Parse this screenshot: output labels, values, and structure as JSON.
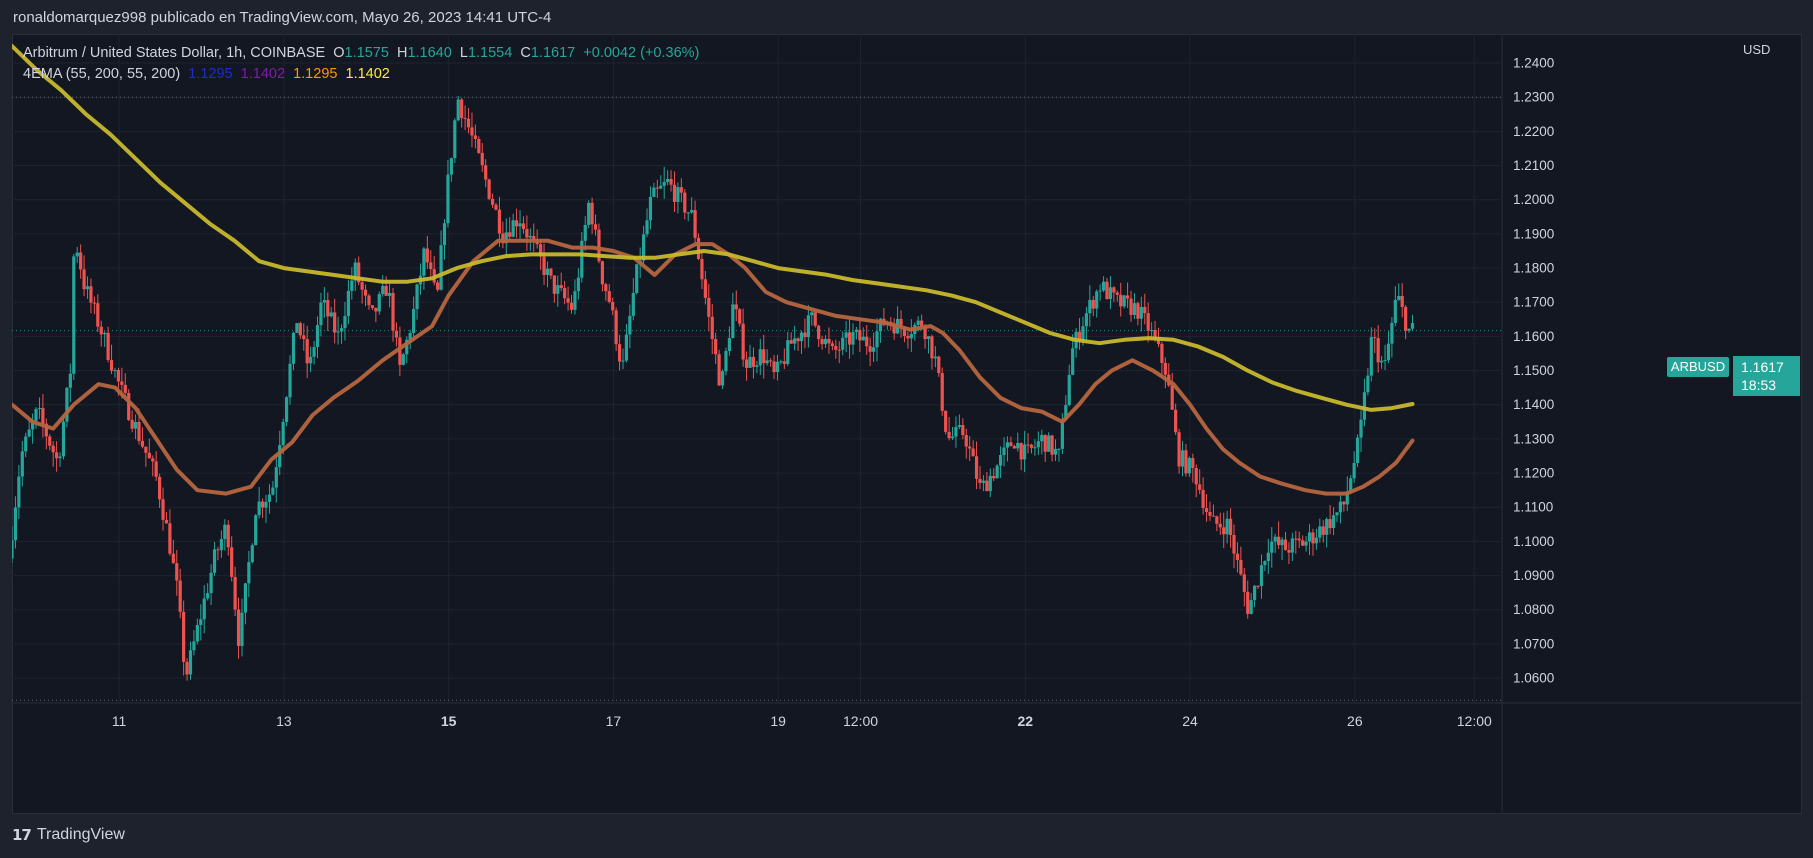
{
  "header": {
    "publisher_line": "ronaldomarquez998 publicado en TradingView.com, Mayo 26, 2023 14:41 UTC-4"
  },
  "legend": {
    "symbol_line": "Arbitrum / United States Dollar, 1h, COINBASE",
    "o_label": "O",
    "o_value": "1.1575",
    "h_label": "H",
    "h_value": "1.1640",
    "l_label": "L",
    "l_value": "1.1554",
    "c_label": "C",
    "c_value": "1.1617",
    "change": "+0.0042 (+0.36%)",
    "indicator_name": "4EMA (55, 200, 55, 200)",
    "ema_values": [
      {
        "value": "1.1295",
        "color": "#1f2bcc"
      },
      {
        "value": "1.1402",
        "color": "#7b1fa2"
      },
      {
        "value": "1.1295",
        "color": "#ff9800"
      },
      {
        "value": "1.1402",
        "color": "#ffeb3b"
      }
    ]
  },
  "price_badge": {
    "symbol": "ARBUSD",
    "price": "1.1617",
    "countdown": "18:53"
  },
  "footer": {
    "brand": "TradingView"
  },
  "colors": {
    "up": "#26a69a",
    "down": "#ef5350",
    "ema55": "#b5653e",
    "ema200": "#c8b82c",
    "background": "#131722",
    "grid": "#2a2e39"
  },
  "chart_data": {
    "type": "candlestick",
    "title": "Arbitrum / United States Dollar, 1h, COINBASE",
    "currency_label": "USD",
    "ylim": [
      1.053,
      1.2485
    ],
    "y_ticks": [
      "1.2400",
      "1.2300",
      "1.2200",
      "1.2100",
      "1.2000",
      "1.1900",
      "1.1800",
      "1.1700",
      "1.1600",
      "1.1500",
      "1.1400",
      "1.1300",
      "1.1200",
      "1.1100",
      "1.1000",
      "1.0900",
      "1.0800",
      "1.0700",
      "1.0600"
    ],
    "x_ticks": [
      {
        "label": "11",
        "bold": false,
        "day": 11.0
      },
      {
        "label": "13",
        "bold": false,
        "day": 13.0
      },
      {
        "label": "15",
        "bold": true,
        "day": 15.0
      },
      {
        "label": "17",
        "bold": false,
        "day": 17.0
      },
      {
        "label": "19",
        "bold": false,
        "day": 19.0
      },
      {
        "label": "12:00",
        "bold": false,
        "day": 20.0
      },
      {
        "label": "22",
        "bold": true,
        "day": 22.0
      },
      {
        "label": "24",
        "bold": false,
        "day": 24.0
      },
      {
        "label": "26",
        "bold": false,
        "day": 26.0
      },
      {
        "label": "12:00",
        "bold": false,
        "day": 27.45
      }
    ],
    "xlim_day": [
      9.7,
      27.75
    ],
    "reference_levels": [
      1.23,
      1.1617,
      1.0535
    ],
    "price_anchors": [
      [
        9.7,
        1.095
      ],
      [
        9.85,
        1.125
      ],
      [
        10.05,
        1.138
      ],
      [
        10.3,
        1.123
      ],
      [
        10.45,
        1.15
      ],
      [
        10.5,
        1.19
      ],
      [
        10.62,
        1.175
      ],
      [
        10.85,
        1.16
      ],
      [
        11.05,
        1.145
      ],
      [
        11.3,
        1.13
      ],
      [
        11.5,
        1.118
      ],
      [
        11.65,
        1.1
      ],
      [
        11.75,
        1.085
      ],
      [
        11.85,
        1.06
      ],
      [
        12.05,
        1.08
      ],
      [
        12.2,
        1.095
      ],
      [
        12.35,
        1.105
      ],
      [
        12.5,
        1.07
      ],
      [
        12.7,
        1.11
      ],
      [
        12.9,
        1.115
      ],
      [
        13.05,
        1.14
      ],
      [
        13.2,
        1.165
      ],
      [
        13.35,
        1.15
      ],
      [
        13.5,
        1.17
      ],
      [
        13.7,
        1.16
      ],
      [
        13.9,
        1.18
      ],
      [
        14.1,
        1.165
      ],
      [
        14.3,
        1.175
      ],
      [
        14.45,
        1.15
      ],
      [
        14.6,
        1.165
      ],
      [
        14.75,
        1.185
      ],
      [
        14.9,
        1.17
      ],
      [
        15.0,
        1.198
      ],
      [
        15.15,
        1.23
      ],
      [
        15.3,
        1.22
      ],
      [
        15.5,
        1.205
      ],
      [
        15.7,
        1.19
      ],
      [
        15.9,
        1.195
      ],
      [
        16.1,
        1.185
      ],
      [
        16.3,
        1.175
      ],
      [
        16.55,
        1.168
      ],
      [
        16.75,
        1.2
      ],
      [
        16.9,
        1.178
      ],
      [
        17.0,
        1.17
      ],
      [
        17.15,
        1.15
      ],
      [
        17.3,
        1.175
      ],
      [
        17.5,
        1.2
      ],
      [
        17.7,
        1.205
      ],
      [
        17.85,
        1.2
      ],
      [
        18.0,
        1.195
      ],
      [
        18.1,
        1.18
      ],
      [
        18.2,
        1.165
      ],
      [
        18.35,
        1.145
      ],
      [
        18.5,
        1.17
      ],
      [
        18.65,
        1.152
      ],
      [
        18.85,
        1.155
      ],
      [
        19.0,
        1.148
      ],
      [
        19.2,
        1.158
      ],
      [
        19.45,
        1.165
      ],
      [
        19.7,
        1.155
      ],
      [
        19.95,
        1.16
      ],
      [
        20.15,
        1.158
      ],
      [
        20.35,
        1.165
      ],
      [
        20.6,
        1.162
      ],
      [
        20.8,
        1.164
      ],
      [
        20.95,
        1.153
      ],
      [
        21.1,
        1.13
      ],
      [
        21.3,
        1.132
      ],
      [
        21.5,
        1.115
      ],
      [
        21.7,
        1.122
      ],
      [
        21.9,
        1.13
      ],
      [
        22.05,
        1.125
      ],
      [
        22.25,
        1.13
      ],
      [
        22.45,
        1.125
      ],
      [
        22.6,
        1.155
      ],
      [
        22.75,
        1.165
      ],
      [
        22.95,
        1.175
      ],
      [
        23.15,
        1.17
      ],
      [
        23.4,
        1.168
      ],
      [
        23.55,
        1.162
      ],
      [
        23.75,
        1.15
      ],
      [
        23.9,
        1.125
      ],
      [
        24.1,
        1.12
      ],
      [
        24.3,
        1.105
      ],
      [
        24.5,
        1.105
      ],
      [
        24.75,
        1.08
      ],
      [
        25.0,
        1.1
      ],
      [
        25.2,
        1.098
      ],
      [
        25.45,
        1.1
      ],
      [
        25.7,
        1.105
      ],
      [
        25.9,
        1.11
      ],
      [
        26.1,
        1.13
      ],
      [
        26.25,
        1.16
      ],
      [
        26.4,
        1.15
      ],
      [
        26.55,
        1.172
      ],
      [
        26.7,
        1.1617
      ]
    ],
    "series": [
      {
        "name": "EMA 55",
        "color": "#b5653e",
        "points": [
          [
            9.7,
            1.14
          ],
          [
            9.95,
            1.135
          ],
          [
            10.2,
            1.133
          ],
          [
            10.45,
            1.14
          ],
          [
            10.75,
            1.146
          ],
          [
            10.95,
            1.145
          ],
          [
            11.2,
            1.139
          ],
          [
            11.45,
            1.13
          ],
          [
            11.7,
            1.121
          ],
          [
            11.95,
            1.115
          ],
          [
            12.3,
            1.114
          ],
          [
            12.6,
            1.116
          ],
          [
            12.85,
            1.124
          ],
          [
            13.1,
            1.129
          ],
          [
            13.35,
            1.137
          ],
          [
            13.6,
            1.142
          ],
          [
            13.9,
            1.147
          ],
          [
            14.2,
            1.153
          ],
          [
            14.5,
            1.158
          ],
          [
            14.8,
            1.163
          ],
          [
            15.0,
            1.172
          ],
          [
            15.3,
            1.182
          ],
          [
            15.6,
            1.188
          ],
          [
            15.9,
            1.188
          ],
          [
            16.2,
            1.188
          ],
          [
            16.5,
            1.186
          ],
          [
            16.75,
            1.186
          ],
          [
            17.0,
            1.185
          ],
          [
            17.25,
            1.183
          ],
          [
            17.5,
            1.178
          ],
          [
            17.75,
            1.184
          ],
          [
            18.0,
            1.187
          ],
          [
            18.2,
            1.187
          ],
          [
            18.4,
            1.184
          ],
          [
            18.6,
            1.18
          ],
          [
            18.85,
            1.173
          ],
          [
            19.1,
            1.17
          ],
          [
            19.4,
            1.168
          ],
          [
            19.7,
            1.166
          ],
          [
            20.0,
            1.165
          ],
          [
            20.3,
            1.164
          ],
          [
            20.6,
            1.162
          ],
          [
            20.85,
            1.163
          ],
          [
            21.0,
            1.161
          ],
          [
            21.2,
            1.156
          ],
          [
            21.45,
            1.148
          ],
          [
            21.7,
            1.142
          ],
          [
            21.95,
            1.139
          ],
          [
            22.2,
            1.138
          ],
          [
            22.45,
            1.135
          ],
          [
            22.65,
            1.14
          ],
          [
            22.85,
            1.146
          ],
          [
            23.05,
            1.15
          ],
          [
            23.3,
            1.153
          ],
          [
            23.55,
            1.15
          ],
          [
            23.8,
            1.146
          ],
          [
            24.0,
            1.14
          ],
          [
            24.2,
            1.133
          ],
          [
            24.4,
            1.127
          ],
          [
            24.6,
            1.123
          ],
          [
            24.85,
            1.119
          ],
          [
            25.1,
            1.117
          ],
          [
            25.4,
            1.115
          ],
          [
            25.65,
            1.114
          ],
          [
            25.9,
            1.114
          ],
          [
            26.1,
            1.116
          ],
          [
            26.3,
            1.119
          ],
          [
            26.5,
            1.123
          ],
          [
            26.7,
            1.1295
          ]
        ]
      },
      {
        "name": "EMA 200",
        "color": "#c8b82c",
        "points": [
          [
            9.7,
            1.245
          ],
          [
            10.0,
            1.238
          ],
          [
            10.3,
            1.232
          ],
          [
            10.6,
            1.225
          ],
          [
            10.9,
            1.219
          ],
          [
            11.2,
            1.212
          ],
          [
            11.5,
            1.205
          ],
          [
            11.8,
            1.199
          ],
          [
            12.1,
            1.193
          ],
          [
            12.4,
            1.188
          ],
          [
            12.7,
            1.182
          ],
          [
            13.0,
            1.18
          ],
          [
            13.3,
            1.179
          ],
          [
            13.6,
            1.178
          ],
          [
            13.9,
            1.177
          ],
          [
            14.2,
            1.176
          ],
          [
            14.5,
            1.176
          ],
          [
            14.8,
            1.177
          ],
          [
            15.1,
            1.18
          ],
          [
            15.4,
            1.182
          ],
          [
            15.7,
            1.1835
          ],
          [
            16.0,
            1.184
          ],
          [
            16.3,
            1.184
          ],
          [
            16.6,
            1.184
          ],
          [
            16.9,
            1.1835
          ],
          [
            17.2,
            1.183
          ],
          [
            17.5,
            1.183
          ],
          [
            17.8,
            1.184
          ],
          [
            18.1,
            1.185
          ],
          [
            18.4,
            1.184
          ],
          [
            18.7,
            1.182
          ],
          [
            19.0,
            1.18
          ],
          [
            19.3,
            1.179
          ],
          [
            19.6,
            1.178
          ],
          [
            19.9,
            1.1765
          ],
          [
            20.2,
            1.1755
          ],
          [
            20.5,
            1.1745
          ],
          [
            20.8,
            1.1735
          ],
          [
            21.1,
            1.172
          ],
          [
            21.4,
            1.17
          ],
          [
            21.7,
            1.167
          ],
          [
            22.0,
            1.164
          ],
          [
            22.3,
            1.161
          ],
          [
            22.6,
            1.159
          ],
          [
            22.9,
            1.158
          ],
          [
            23.2,
            1.159
          ],
          [
            23.5,
            1.1595
          ],
          [
            23.8,
            1.159
          ],
          [
            24.1,
            1.157
          ],
          [
            24.4,
            1.154
          ],
          [
            24.7,
            1.15
          ],
          [
            25.0,
            1.1465
          ],
          [
            25.3,
            1.144
          ],
          [
            25.6,
            1.142
          ],
          [
            25.9,
            1.14
          ],
          [
            26.2,
            1.1385
          ],
          [
            26.45,
            1.139
          ],
          [
            26.7,
            1.1402
          ]
        ]
      }
    ]
  }
}
